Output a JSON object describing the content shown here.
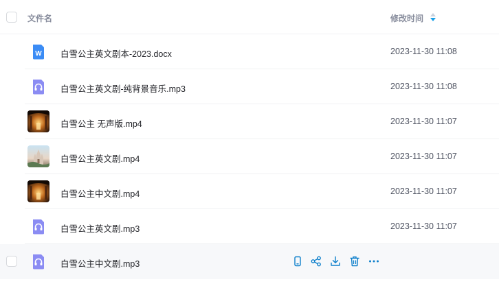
{
  "header": {
    "name_label": "文件名",
    "time_label": "修改时间",
    "sort_icon": "sort-icon"
  },
  "files": [
    {
      "name": "白雪公主英文剧本-2023.docx",
      "modified": "2023-11-30 11:08",
      "type": "word-doc-icon"
    },
    {
      "name": "白雪公主英文剧-纯背景音乐.mp3",
      "modified": "2023-11-30 11:08",
      "type": "audio-file-icon"
    },
    {
      "name": "白雪公主 无声版.mp4",
      "modified": "2023-11-30 11:07",
      "type": "video-thumbnail"
    },
    {
      "name": "白雪公主英文剧.mp4",
      "modified": "2023-11-30 11:07",
      "type": "video-thumbnail"
    },
    {
      "name": "白雪公主中文剧.mp4",
      "modified": "2023-11-30 11:07",
      "type": "video-thumbnail"
    },
    {
      "name": "白雪公主英文剧.mp3",
      "modified": "2023-11-30 11:07",
      "type": "audio-file-icon"
    },
    {
      "name": "白雪公主中文剧.mp3",
      "modified": "",
      "type": "audio-file-icon"
    }
  ],
  "hover_actions": [
    "phone-icon",
    "share-icon",
    "download-icon",
    "delete-icon",
    "more-icon"
  ],
  "colors": {
    "accent": "#0d7fcb",
    "audio_icon": "#8b8cf3",
    "word_icon": "#3b8cf5",
    "hover_row": "#f7f8fa"
  }
}
